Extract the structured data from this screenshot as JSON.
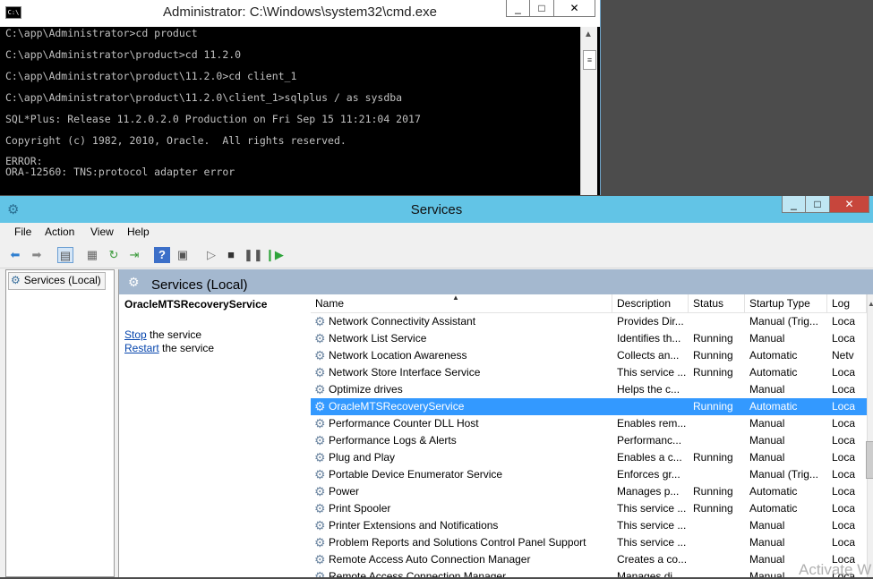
{
  "cmd": {
    "title": "Administrator: C:\\Windows\\system32\\cmd.exe",
    "icon": "C:\\",
    "buttons": {
      "minimize": "_",
      "maximize": "□",
      "close": "✕"
    },
    "lines": [
      "C:\\app\\Administrator>cd product",
      "C:\\app\\Administrator\\product>cd 11.2.0",
      "C:\\app\\Administrator\\product\\11.2.0>cd client_1",
      "C:\\app\\Administrator\\product\\11.2.0\\client_1>sqlplus / as sysdba",
      "SQL*Plus: Release 11.2.0.2.0 Production on Fri Sep 15 11:21:04 2017",
      "Copyright (c) 1982, 2010, Oracle.  All rights reserved.",
      "ERROR:",
      "ORA-12560: TNS:protocol adapter error"
    ]
  },
  "services": {
    "title": "Services",
    "buttons": {
      "minimize": "_",
      "maximize": "□",
      "close": "✕"
    },
    "menu": [
      "File",
      "Action",
      "View",
      "Help"
    ],
    "tree_node": "Services (Local)",
    "header_title": "Services (Local)",
    "selected_service": "OracleMTSRecoveryService",
    "actions": {
      "stop_link": "Stop",
      "stop_suffix": " the service",
      "restart_link": "Restart",
      "restart_suffix": " the service"
    },
    "columns": [
      "Name",
      "Description",
      "Status",
      "Startup Type",
      "Log"
    ],
    "rows": [
      {
        "name": "Network Connectivity Assistant",
        "desc": "Provides Dir...",
        "status": "",
        "startup": "Manual (Trig...",
        "log": "Loca"
      },
      {
        "name": "Network List Service",
        "desc": "Identifies th...",
        "status": "Running",
        "startup": "Manual",
        "log": "Loca"
      },
      {
        "name": "Network Location Awareness",
        "desc": "Collects an...",
        "status": "Running",
        "startup": "Automatic",
        "log": "Netv"
      },
      {
        "name": "Network Store Interface Service",
        "desc": "This service ...",
        "status": "Running",
        "startup": "Automatic",
        "log": "Loca"
      },
      {
        "name": "Optimize drives",
        "desc": "Helps the c...",
        "status": "",
        "startup": "Manual",
        "log": "Loca"
      },
      {
        "name": "OracleMTSRecoveryService",
        "desc": "",
        "status": "Running",
        "startup": "Automatic",
        "log": "Loca",
        "selected": true
      },
      {
        "name": "Performance Counter DLL Host",
        "desc": "Enables rem...",
        "status": "",
        "startup": "Manual",
        "log": "Loca"
      },
      {
        "name": "Performance Logs & Alerts",
        "desc": "Performanc...",
        "status": "",
        "startup": "Manual",
        "log": "Loca"
      },
      {
        "name": "Plug and Play",
        "desc": "Enables a c...",
        "status": "Running",
        "startup": "Manual",
        "log": "Loca"
      },
      {
        "name": "Portable Device Enumerator Service",
        "desc": "Enforces gr...",
        "status": "",
        "startup": "Manual (Trig...",
        "log": "Loca"
      },
      {
        "name": "Power",
        "desc": "Manages p...",
        "status": "Running",
        "startup": "Automatic",
        "log": "Loca"
      },
      {
        "name": "Print Spooler",
        "desc": "This service ...",
        "status": "Running",
        "startup": "Automatic",
        "log": "Loca"
      },
      {
        "name": "Printer Extensions and Notifications",
        "desc": "This service ...",
        "status": "",
        "startup": "Manual",
        "log": "Loca"
      },
      {
        "name": "Problem Reports and Solutions Control Panel Support",
        "desc": "This service ...",
        "status": "",
        "startup": "Manual",
        "log": "Loca"
      },
      {
        "name": "Remote Access Auto Connection Manager",
        "desc": "Creates a co...",
        "status": "",
        "startup": "Manual",
        "log": "Loca"
      },
      {
        "name": "Remote Access Connection Manager",
        "desc": "Manages di...",
        "status": "",
        "startup": "Manual",
        "log": "Loca"
      }
    ]
  },
  "watermark": "Activate W",
  "colors": {
    "selection": "#3399ff",
    "titlebar_services": "#62c4e6",
    "header_band": "#a4b8cf"
  }
}
